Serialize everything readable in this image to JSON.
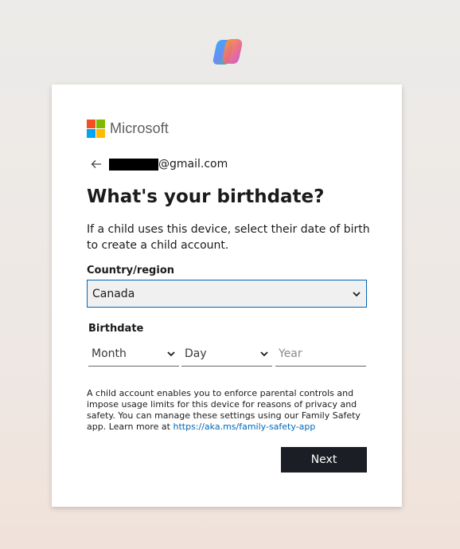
{
  "logo": {
    "icon": "copilot-logo-icon",
    "wordmark": "Microsoft",
    "squares": [
      "#f25022",
      "#7fba00",
      "#00a4ef",
      "#ffb900"
    ]
  },
  "identity": {
    "email_suffix": "@gmail.com"
  },
  "title": "What's your birthdate?",
  "description": "If a child uses this device, select their date of birth to create a child account.",
  "country": {
    "label": "Country/region",
    "value": "Canada"
  },
  "birthdate": {
    "label": "Birthdate",
    "month": "Month",
    "day": "Day",
    "year_placeholder": "Year"
  },
  "info": {
    "text": "A child account enables you to enforce parental controls and impose usage limits for this device for reasons of privacy and safety. You can manage these settings using our Family Safety app. Learn more at ",
    "link": "https://aka.ms/family-safety-app"
  },
  "buttons": {
    "next": "Next"
  },
  "colors": {
    "accent": "#0067b8",
    "button": "#1b1e24"
  }
}
